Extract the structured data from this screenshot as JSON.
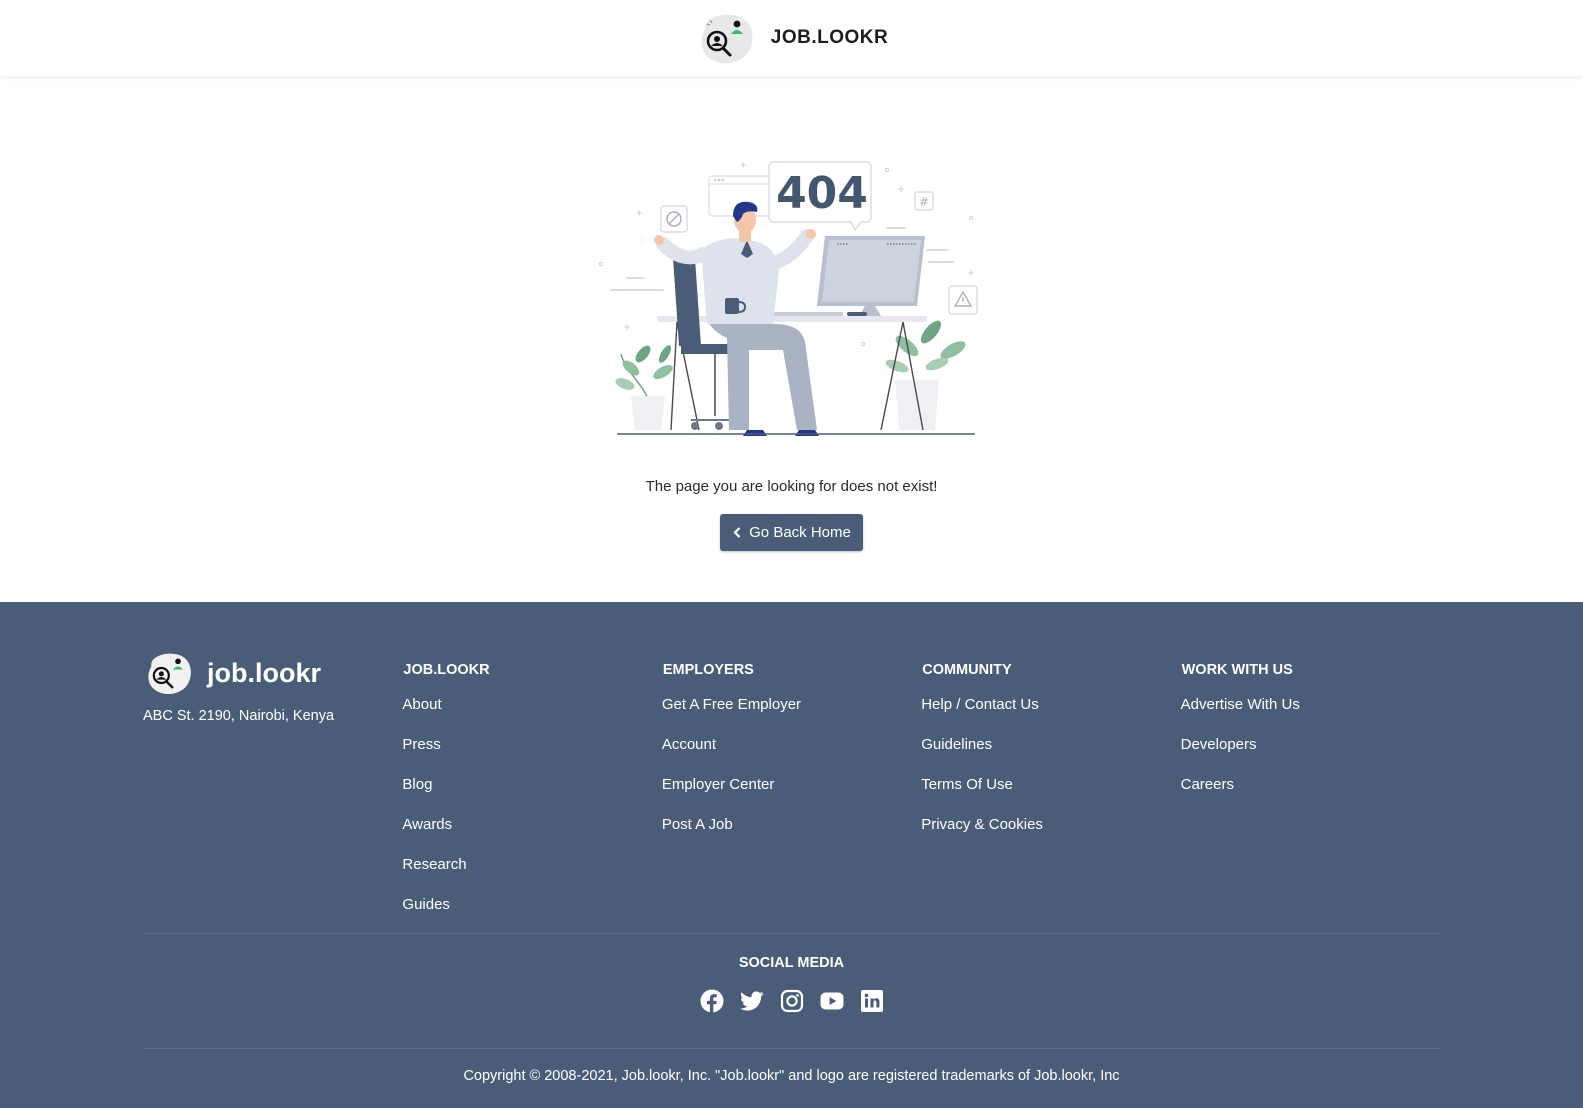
{
  "header": {
    "brand": "JOB.LOOKR"
  },
  "main": {
    "illustration_text": "404",
    "message": "The page you are looking for does not exist!",
    "button_label": "Go Back Home"
  },
  "footer": {
    "brand_name": "job.lookr",
    "address": "ABC St. 2190, Nairobi, Kenya",
    "columns": [
      {
        "title": "JOB.LOOKR",
        "links": [
          "About",
          "Press",
          "Blog",
          "Awards",
          "Research",
          "Guides"
        ]
      },
      {
        "title": "EMPLOYERS",
        "links": [
          "Get A Free Employer",
          "Account",
          "Employer Center",
          "Post A Job"
        ]
      },
      {
        "title": "COMMUNITY",
        "links": [
          "Help / Contact Us",
          "Guidelines",
          "Terms Of Use",
          "Privacy & Cookies"
        ]
      },
      {
        "title": "WORK WITH US",
        "links": [
          "Advertise With Us",
          "Developers",
          "Careers"
        ]
      }
    ],
    "social_title": "SOCIAL MEDIA",
    "social_icons": [
      "facebook-icon",
      "twitter-icon",
      "instagram-icon",
      "youtube-icon",
      "linkedin-icon"
    ],
    "copyright": "Copyright © 2008-2021, Job.lookr, Inc. \"Job.lookr\" and logo are registered trademarks of Job.lookr, Inc"
  },
  "colors": {
    "primary": "#4a5d78",
    "accent_green": "#2fbf71",
    "background": "#ffffff"
  }
}
